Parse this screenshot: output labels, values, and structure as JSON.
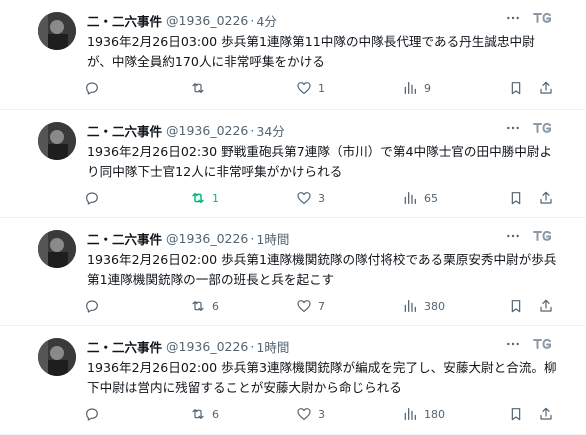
{
  "tweets": [
    {
      "name": "二・二六事件",
      "handle": "@1936_0226",
      "dot": "·",
      "time": "4分",
      "text": "1936年2月26日03:00 歩兵第1連隊第11中隊の中隊長代理である丹生誠忠中尉が、中隊全員約170人に非常呼集をかける",
      "retweets": "",
      "likes": "1",
      "views": "9",
      "retweeted": false
    },
    {
      "name": "二・二六事件",
      "handle": "@1936_0226",
      "dot": "·",
      "time": "34分",
      "text": "1936年2月26日02:30 野戦重砲兵第7連隊（市川）で第4中隊士官の田中勝中尉より同中隊下士官12人に非常呼集がかけられる",
      "retweets": "1",
      "likes": "3",
      "views": "65",
      "retweeted": true
    },
    {
      "name": "二・二六事件",
      "handle": "@1936_0226",
      "dot": "·",
      "time": "1時間",
      "text": "1936年2月26日02:00 歩兵第1連隊機関銃隊の隊付将校である栗原安秀中尉が歩兵第1連隊機関銃隊の一部の班長と兵を起こす",
      "retweets": "6",
      "likes": "7",
      "views": "380",
      "retweeted": false
    },
    {
      "name": "二・二六事件",
      "handle": "@1936_0226",
      "dot": "·",
      "time": "1時間",
      "text": "1936年2月26日02:00 歩兵第3連隊機関銃隊が編成を完了し、安藤大尉と合流。柳下中尉は営内に残留することが安藤大尉から命じられる",
      "retweets": "6",
      "likes": "3",
      "views": "180",
      "retweeted": false
    }
  ],
  "icons": {
    "reply": "reply-icon",
    "retweet": "retweet-icon",
    "like": "heart-icon",
    "views": "views-icon",
    "bookmark": "bookmark-icon",
    "share": "share-icon",
    "more": "more-icon",
    "grok": "grok-icon"
  },
  "colors": {
    "text": "#0f1419",
    "secondary": "#536471",
    "retweet_active": "#00ba7c",
    "divider": "#eff3f4"
  }
}
